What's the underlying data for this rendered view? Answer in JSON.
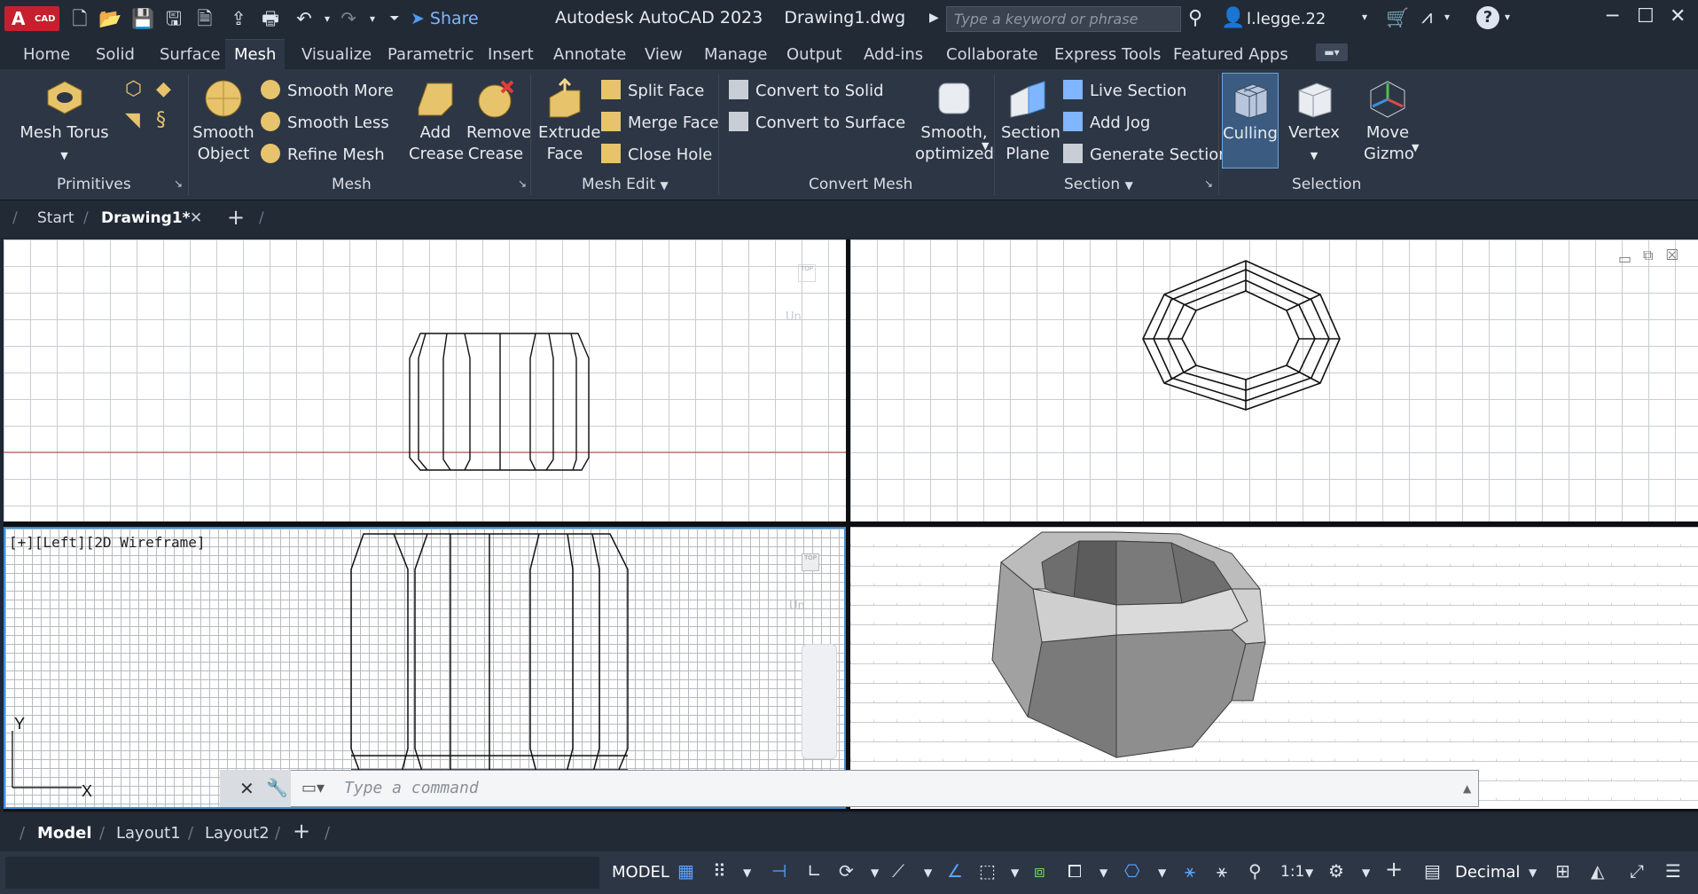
{
  "app": {
    "logo_text": "A",
    "logo_sub": "CAD",
    "title": "Autodesk AutoCAD 2023    Drawing1.dwg",
    "share_label": "Share",
    "search_placeholder": "Type a keyword or phrase",
    "user_name": "l.legge.22"
  },
  "ribbon_tabs": [
    "Home",
    "Solid",
    "Surface",
    "Mesh",
    "Visualize",
    "Parametric",
    "Insert",
    "Annotate",
    "View",
    "Manage",
    "Output",
    "Add-ins",
    "Collaborate",
    "Express Tools",
    "Featured Apps"
  ],
  "active_tab": "Mesh",
  "ribbon": {
    "primitives": {
      "label": "Primitives",
      "mesh_torus": "Mesh Torus"
    },
    "mesh": {
      "label": "Mesh",
      "smooth_object": "Smooth Object",
      "smooth_more": "Smooth More",
      "smooth_less": "Smooth Less",
      "refine_mesh": "Refine Mesh"
    },
    "mesh_edit": {
      "label": "Mesh Edit",
      "add_crease": "Add Crease",
      "remove_crease": "Remove Crease",
      "extrude_face": "Extrude Face",
      "split_face": "Split Face",
      "merge_face": "Merge Face",
      "close_hole": "Close Hole"
    },
    "convert_mesh": {
      "label": "Convert Mesh",
      "convert_to_solid": "Convert to Solid",
      "convert_to_surface": "Convert to Surface",
      "smooth_optimized": "Smooth, optimized"
    },
    "section": {
      "label": "Section",
      "section_plane": "Section Plane",
      "live_section": "Live Section",
      "add_jog": "Add Jog",
      "generate_section": "Generate Section"
    },
    "selection": {
      "label": "Selection",
      "culling": "Culling",
      "vertex": "Vertex",
      "move_gizmo": "Move Gizmo"
    }
  },
  "file_tabs": {
    "start": "Start",
    "active": "Drawing1*"
  },
  "viewport_label": "[+][Left][2D Wireframe]",
  "viewcube_label": "Un",
  "command_placeholder": "Type a command",
  "layout_tabs": [
    "Model",
    "Layout1",
    "Layout2"
  ],
  "status": {
    "model": "MODEL",
    "scale": "1:1",
    "units": "Decimal"
  },
  "colors": {
    "accent": "#5aa4ff",
    "logo_red": "#c81f2e",
    "viewport_border": "#3d8fd6"
  }
}
